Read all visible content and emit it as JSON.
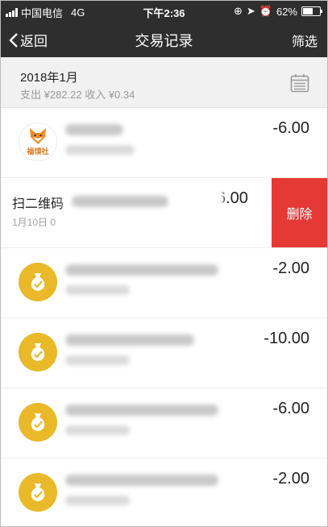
{
  "status_bar": {
    "carrier": "中国电信",
    "network": "4G",
    "time": "下午2:36",
    "battery": "62%",
    "battery_level": 0.62
  },
  "nav": {
    "back_label": "返回",
    "title": "交易记录",
    "filter_label": "筛选"
  },
  "month": {
    "title": "2018年1月",
    "summary": "支出 ¥282.22  收入 ¥0.34"
  },
  "transactions": [
    {
      "amount": "-6.00"
    },
    {
      "title": "扫二维码",
      "date": "1月10日 0",
      "amount": "6.00",
      "delete_label": "删除"
    },
    {
      "amount": "-2.00"
    },
    {
      "amount": "-10.00"
    },
    {
      "amount": "-6.00"
    },
    {
      "amount": "-2.00"
    }
  ],
  "merchant_logo_text": "福馍社",
  "colors": {
    "nav_bg": "#2e2e2e",
    "delete_red": "#e53935",
    "gold": "#e9b929"
  }
}
